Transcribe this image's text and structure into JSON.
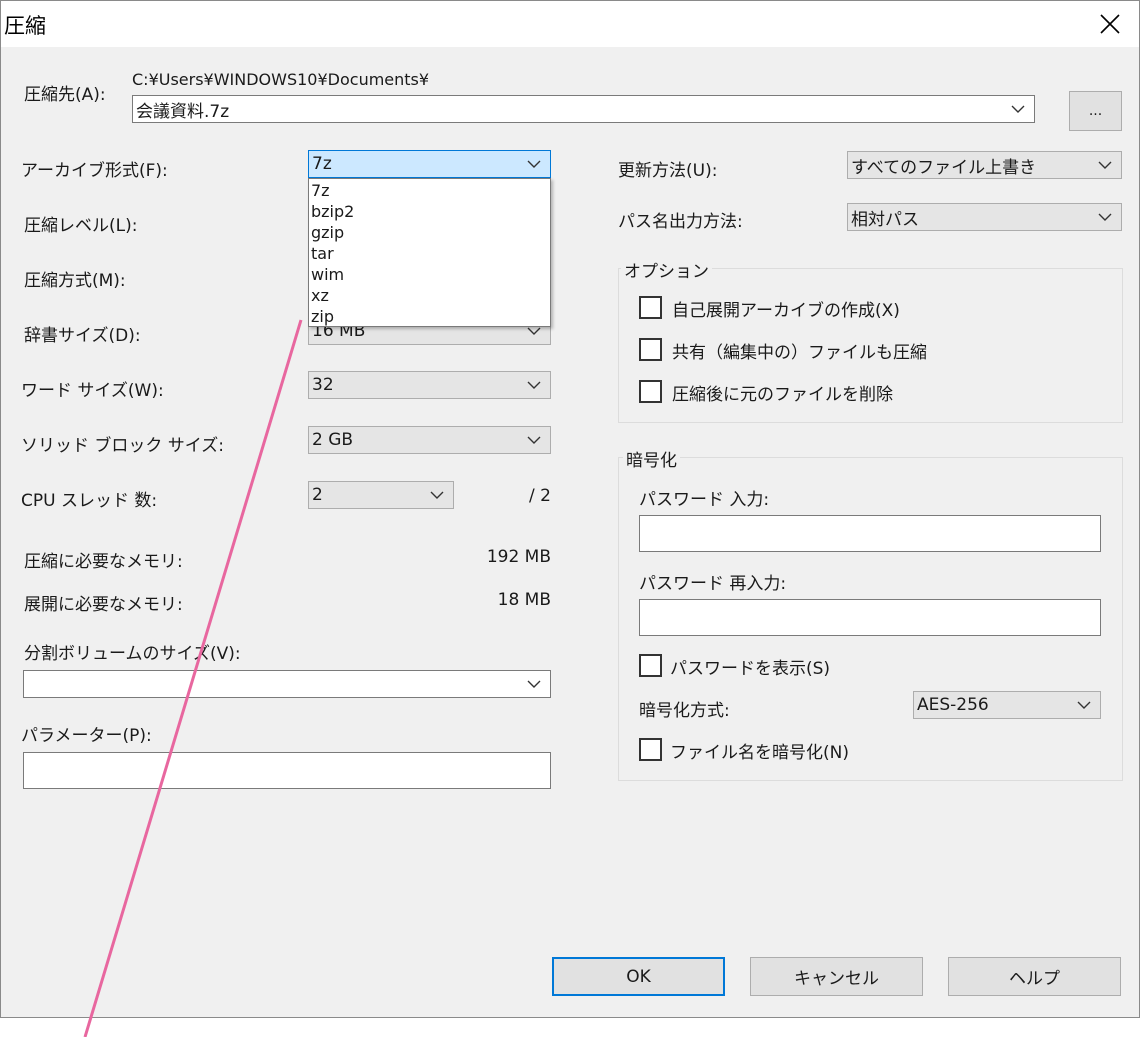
{
  "window": {
    "title": "圧縮"
  },
  "destination": {
    "label": "圧縮先(A):",
    "path": "C:¥Users¥WINDOWS10¥Documents¥",
    "filename": "会議資料.7z",
    "browse_label": "..."
  },
  "left": {
    "archive_format": {
      "label": "アーカイブ形式(F):",
      "value": "7z"
    },
    "compression_level": {
      "label": "圧縮レベル(L):"
    },
    "compression_method": {
      "label": "圧縮方式(M):"
    },
    "dictionary_size": {
      "label": "辞書サイズ(D):",
      "value": "16 MB"
    },
    "word_size": {
      "label": "ワード サイズ(W):",
      "value": "32"
    },
    "solid_block_size": {
      "label": "ソリッド ブロック サイズ:",
      "value": "2 GB"
    },
    "cpu_threads": {
      "label": "CPU スレッド 数:",
      "value": "2",
      "total": "/ 2"
    },
    "memory_compress": {
      "label": "圧縮に必要なメモリ:",
      "value": "192 MB"
    },
    "memory_decompress": {
      "label": "展開に必要なメモリ:",
      "value": "18 MB"
    },
    "split_volume": {
      "label": "分割ボリュームのサイズ(V):",
      "value": ""
    },
    "parameters": {
      "label": "パラメーター(P):",
      "value": ""
    }
  },
  "format_dropdown": {
    "options": [
      "7z",
      "bzip2",
      "gzip",
      "tar",
      "wim",
      "xz",
      "zip"
    ]
  },
  "right": {
    "update_mode": {
      "label": "更新方法(U):",
      "value": "すべてのファイル上書き"
    },
    "path_mode": {
      "label": "パス名出力方法:",
      "value": "相対パス"
    },
    "options": {
      "title": "オプション",
      "items": [
        {
          "label": "自己展開アーカイブの作成(X)",
          "checked": false
        },
        {
          "label": "共有（編集中の）ファイルも圧縮",
          "checked": false
        },
        {
          "label": "圧縮後に元のファイルを削除",
          "checked": false
        }
      ]
    },
    "encryption": {
      "title": "暗号化",
      "password_label": "パスワード 入力:",
      "password_value": "",
      "reenter_label": "パスワード 再入力:",
      "reenter_value": "",
      "show_password_label": "パスワードを表示(S)",
      "method_label": "暗号化方式:",
      "method_value": "AES-256",
      "encrypt_names_label": "ファイル名を暗号化(N)"
    }
  },
  "buttons": {
    "ok": "OK",
    "cancel": "キャンセル",
    "help": "ヘルプ"
  },
  "colors": {
    "annotation_line": "#e8679f",
    "focus_border": "#0078d7",
    "focus_fill": "#cce8ff"
  }
}
